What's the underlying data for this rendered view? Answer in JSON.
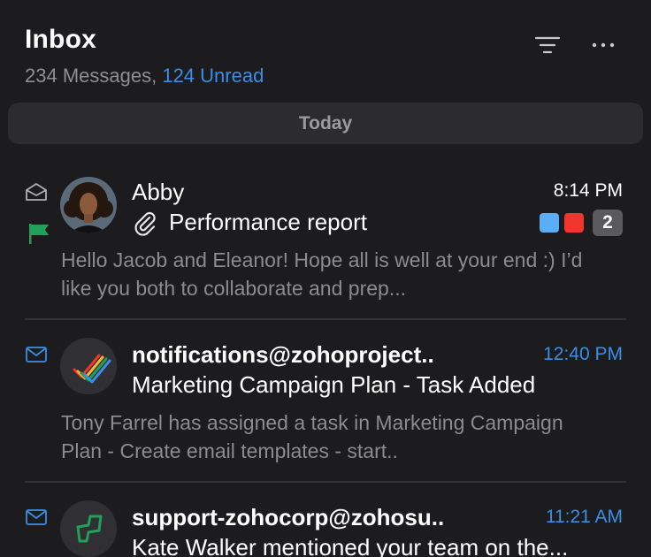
{
  "header": {
    "title": "Inbox",
    "message_count": "234 Messages,",
    "unread_count": "124 Unread"
  },
  "section": {
    "label": "Today"
  },
  "colors": {
    "background": "#1c1c1e",
    "accent": "#3a8ee6",
    "flag": "#21a05a",
    "tag_blue": "#5aaef6",
    "tag_red": "#f0352f"
  },
  "emails": [
    {
      "sender": "Abby",
      "time": "8:14 PM",
      "subject": "Performance report",
      "preview": "Hello Jacob and Eleanor! Hope all is well at your end :) I’d like you both to collaborate and prep...",
      "unread": false,
      "flagged": true,
      "has_attachment": true,
      "thread_count": "2",
      "icons": [
        "envelope-open-icon",
        "flag-icon",
        "paperclip-icon"
      ]
    },
    {
      "sender": "notifications@zohoproject..",
      "time": "12:40 PM",
      "subject": "Marketing Campaign Plan - Task Added",
      "preview": "Tony Farrel has assigned a task in Marketing Campaign Plan - Create email templates - start..",
      "unread": true,
      "icons": [
        "envelope-icon",
        "zoho-projects-logo"
      ]
    },
    {
      "sender": "support-zohocorp@zohosu..",
      "time": "11:21 AM",
      "subject": "Kate Walker mentioned your team on the...",
      "preview": "",
      "unread": true,
      "icons": [
        "envelope-icon",
        "zoho-support-logo"
      ]
    }
  ]
}
